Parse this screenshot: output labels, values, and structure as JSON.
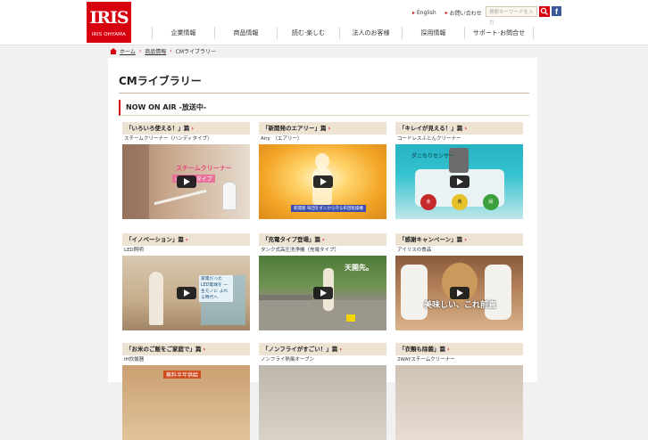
{
  "logo": {
    "mark": "IRIS",
    "sub": "IRIS OHYAMA"
  },
  "top_links": [
    {
      "label": "English"
    },
    {
      "label": "お問い合わせ"
    }
  ],
  "search": {
    "placeholder": "検索キーワードを入力"
  },
  "facebook": "f",
  "nav": [
    {
      "label": "企業情報"
    },
    {
      "label": "商品情報"
    },
    {
      "label": "読む·楽しむ"
    },
    {
      "label": "法人のお客様"
    },
    {
      "label": "採用情報"
    },
    {
      "label": "サポート·お問合せ"
    }
  ],
  "breadcrumb": [
    {
      "label": "ホーム"
    },
    {
      "label": "商品情報"
    },
    {
      "label": "CMライブラリー"
    }
  ],
  "page": {
    "title": "CMライブラリー",
    "section": "NOW ON AIR -放送中-"
  },
  "colors": {
    "brand_red": "#d7000f",
    "card_head": "#eee3d3"
  },
  "cards": [
    {
      "title": "「いろいろ使える！」篇",
      "sub": "スチームクリーナー（ハンディタイプ）",
      "cap1": "スチームクリーナー",
      "cap2": "ハンディタイプ"
    },
    {
      "title": "「新開発のエアリー」篇",
      "sub": "Airy　（エアリー）",
      "cap1": "新開発 布団をダニから守る布団乾燥機"
    },
    {
      "title": "「キレイが見える！」篇",
      "sub": "コードレスふとんクリーナー",
      "cap1": "ダニちりセンサー",
      "cap2": "赤",
      "cap3": "黄",
      "cap4": "緑"
    },
    {
      "title": "「イノベーション」篇",
      "sub": "LED照明",
      "cap1": "家電だった LED電球を 一生モノに よれる時代へ"
    },
    {
      "title": "「充電タイプ登場」篇",
      "sub": "タンク式高圧洗浄機（充電タイプ）",
      "cap1": "天開先。"
    },
    {
      "title": "「感謝キャンペーン」篇",
      "sub": "アイリスの食品",
      "cap1": "美味しい、これ前直"
    },
    {
      "title": "「お米のご飯をご家庭で」篇",
      "sub": "IH炊飯器",
      "cap1": "無料半年供給"
    },
    {
      "title": "「ノンフライがすごい！」篇",
      "sub": "ノンフライ熱風オーブン",
      "cap1": ""
    },
    {
      "title": "「衣類も除菌」篇",
      "sub": "2WAYスチームクリーナー",
      "cap1": ""
    }
  ]
}
